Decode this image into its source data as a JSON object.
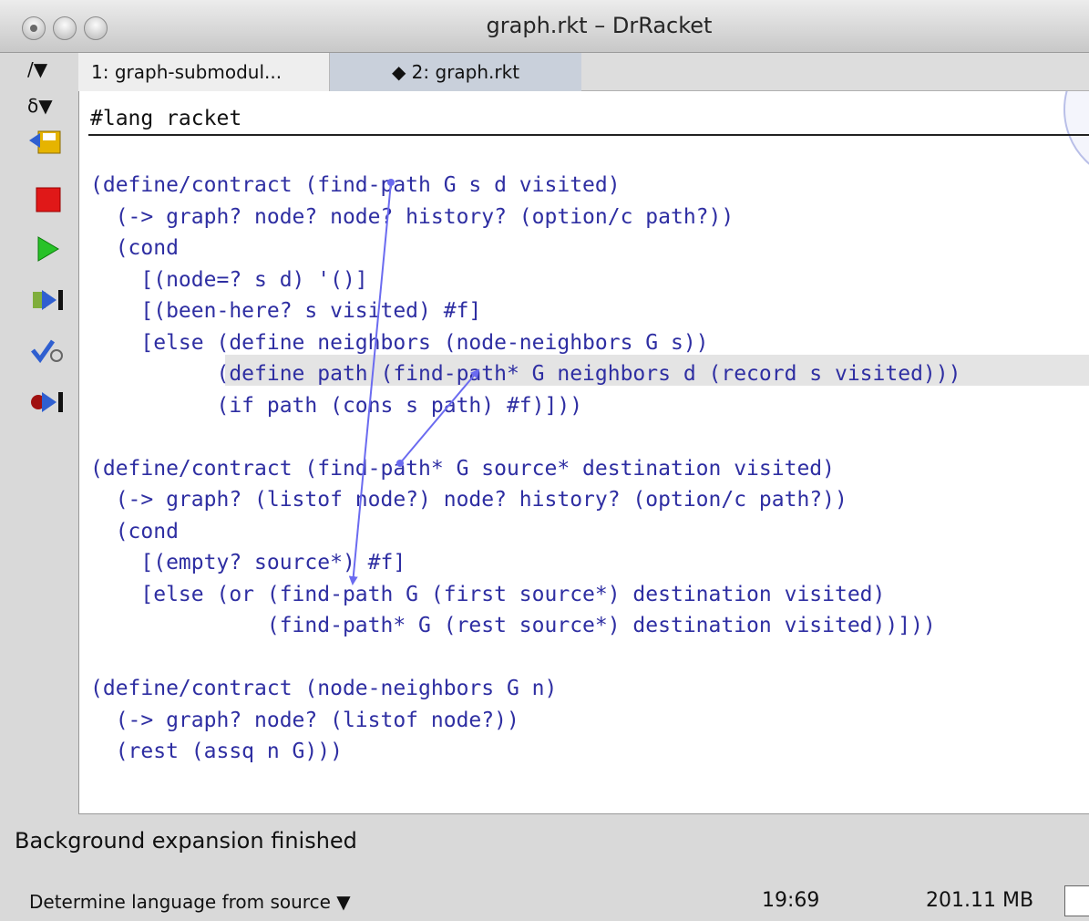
{
  "window": {
    "title": "graph.rkt – DrRacket"
  },
  "toolbar": {
    "menu1": "/▼",
    "menu2": "δ▼"
  },
  "tabs": [
    {
      "label": "1: graph-submodul..."
    },
    {
      "label": "◆ 2: graph.rkt"
    }
  ],
  "editor": {
    "lang_line": "#lang racket",
    "code_lines": [
      "(define/contract (find-path G s d visited)",
      "  (-> graph? node? node? history? (option/c path?))",
      "  (cond",
      "    [(node=? s d) '()]",
      "    [(been-here? s visited) #f]",
      "    [else (define neighbors (node-neighbors G s))",
      "          (define path (find-path* G neighbors d (record s visited)))",
      "          (if path (cons s path) #f)]))",
      "",
      "(define/contract (find-path* G source* destination visited)",
      "  (-> graph? (listof node?) node? history? (option/c path?))",
      "  (cond",
      "    [(empty? source*) #f]",
      "    [else (or (find-path G (first source*) destination visited)",
      "              (find-path* G (rest source*) destination visited))]))",
      "",
      "(define/contract (node-neighbors G n)",
      "  (-> graph? node? (listof node?))",
      "  (rest (assq n G)))"
    ]
  },
  "status": {
    "message": "Background expansion finished",
    "language": "Determine language from source ▼",
    "position": "19:69",
    "memory": "201.11 MB"
  },
  "colors": {
    "code": "#2e2ea2",
    "arrows": "#6b6bf0"
  }
}
